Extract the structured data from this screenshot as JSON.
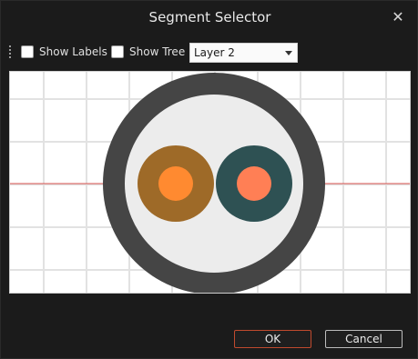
{
  "dialog": {
    "title": "Segment Selector",
    "close_glyph": "✕"
  },
  "toolbar": {
    "show_labels": {
      "label": "Show Labels",
      "checked": false
    },
    "show_tree": {
      "label": "Show Tree",
      "checked": false
    },
    "layer_select": {
      "value": "Layer 2"
    }
  },
  "buttons": {
    "ok": "OK",
    "cancel": "Cancel"
  },
  "colors": {
    "outer_jacket": "#454545",
    "inner_fill": "#ececec",
    "left_ring": "#9e6a28",
    "left_core": "#ff8a30",
    "right_ring": "#2e5153",
    "right_core": "#ff7f55",
    "axis_line": "#d9534f",
    "grid": "#e2e2e2",
    "ok_border": "#c04a2e"
  },
  "icons": {
    "close": "close-icon",
    "dropdown": "chevron-down-icon",
    "grip": "toolbar-grip-icon"
  }
}
